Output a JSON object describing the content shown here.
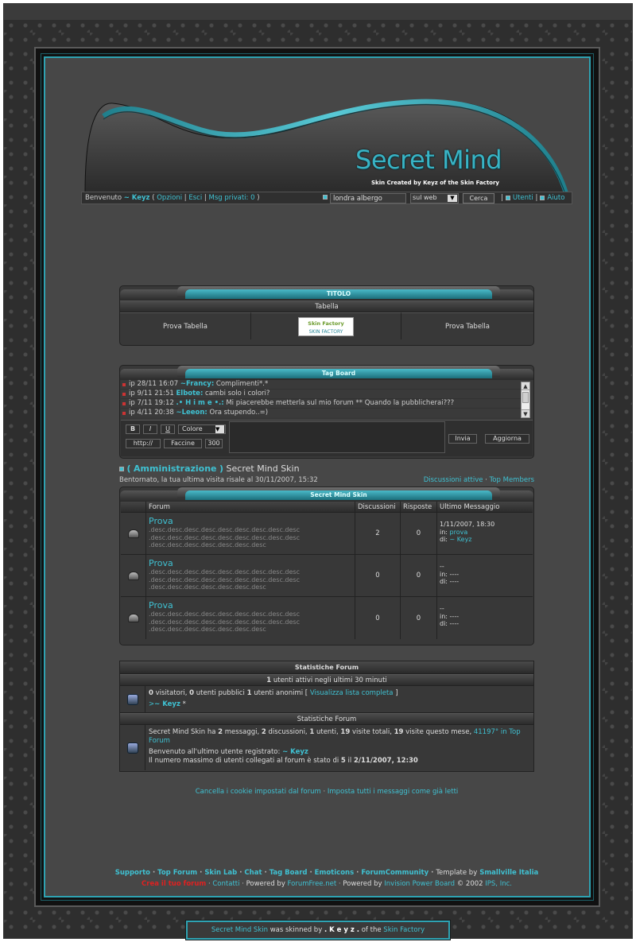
{
  "header": {
    "logo_title": "Secret Mind",
    "logo_subtitle": "Skin Created by Keyz of the Skin Factory"
  },
  "userbar": {
    "welcome": "Benvenuto",
    "user": "~ Keyz",
    "open_paren": "(",
    "options": "Opzioni",
    "sep1": "|",
    "logout": "Esci",
    "sep2": "|",
    "pm": "Msg privati: 0",
    "close_paren": ")",
    "search_value": "londra albergo",
    "search_scope": "sul web",
    "search_button": "Cerca",
    "users": "Utenti",
    "help": "Aiuto"
  },
  "table_panel": {
    "title": "TITOLO",
    "subtitle": "Tabella",
    "cell_left": "Prova Tabella",
    "cell_right": "Prova Tabella",
    "logo_line1": "Skin Factory",
    "logo_line2": "SKIN FACTORY"
  },
  "tagboard": {
    "title": "Tag Board",
    "messages": [
      {
        "ip": "ip",
        "date": "28/11 16:07",
        "user": "~Francy:",
        "text": "Complimenti*.*"
      },
      {
        "ip": "ip",
        "date": "9/11 21:51",
        "user": "Elbote:",
        "text": "cambi solo i colori?"
      },
      {
        "ip": "ip",
        "date": "7/11 19:12",
        "user": ".• H i m e •.:",
        "text": "Mi piacerebbe metterla sul mio forum ** Quando la pubblicherai???"
      },
      {
        "ip": "ip",
        "date": "4/11 20:38",
        "user": "~Leeon:",
        "text": "Ora stupendo..=)"
      }
    ],
    "bold_btn": "B",
    "italic_btn": "I",
    "underline_btn": "U",
    "color_select": "Colore",
    "http_btn": "http://",
    "smilies_btn": "Faccine",
    "char_count": "300",
    "send_btn": "Invia",
    "refresh_btn": "Aggiorna"
  },
  "forum_header": {
    "open": "(",
    "category": "Amministrazione",
    "close": ")",
    "title": "Secret Mind Skin",
    "welcome_back": "Bentornato, la tua ultima visita risale al 30/11/2007, 15:32",
    "active_topics": "Discussioni attive",
    "sep": "·",
    "top_members": "Top Members"
  },
  "forum": {
    "tab_title": "Secret Mind Skin",
    "columns": [
      "Forum",
      "Discussioni",
      "Risposte",
      "Ultimo Messaggio"
    ],
    "rows": [
      {
        "name": "Prova",
        "desc": ".desc.desc.desc.desc.desc.desc.desc.desc.desc .desc.desc.desc.desc.desc.desc.desc.desc.desc .desc.desc.desc.desc.desc.desc.desc",
        "topics": "2",
        "replies": "0",
        "last_date": "1/11/2007, 18:30",
        "last_in_label": "in:",
        "last_in": "prova",
        "last_by_label": "di:",
        "last_by": "~ Keyz"
      },
      {
        "name": "Prova",
        "desc": ".desc.desc.desc.desc.desc.desc.desc.desc.desc .desc.desc.desc.desc.desc.desc.desc.desc.desc .desc.desc.desc.desc.desc.desc.desc",
        "topics": "0",
        "replies": "0",
        "last_date": "--",
        "last_in_label": "in:",
        "last_in": "----",
        "last_by_label": "di:",
        "last_by": "----"
      },
      {
        "name": "Prova",
        "desc": ".desc.desc.desc.desc.desc.desc.desc.desc.desc .desc.desc.desc.desc.desc.desc.desc.desc.desc .desc.desc.desc.desc.desc.desc.desc",
        "topics": "0",
        "replies": "0",
        "last_date": "--",
        "last_in_label": "in:",
        "last_in": "----",
        "last_by_label": "di:",
        "last_by": "----"
      }
    ]
  },
  "stats": {
    "title": "Statistiche Forum",
    "active_count": "1",
    "active_text": "utenti attivi negli ultimi 30 minuti",
    "visitors_count": "0",
    "visitors_label": "visitatori,",
    "public_count": "0",
    "public_label": "utenti pubblici",
    "anon_count": "1",
    "anon_label": "utenti anonimi [",
    "view_list": "Visualizza lista completa",
    "view_list_close": "]",
    "online_user_prefix": ">",
    "online_user": "~ Keyz",
    "online_user_suffix": "*",
    "subtitle": "Statistiche Forum",
    "line1_a": "Secret Mind Skin ha",
    "line1_msgs": "2",
    "line1_b": "messaggi,",
    "line1_disc": "2",
    "line1_c": "discussioni,",
    "line1_users": "1",
    "line1_d": "utenti,",
    "line1_visits": "19",
    "line1_e": "visite totali,",
    "line1_month": "19",
    "line1_f": "visite questo mese,",
    "rank_link": "41197° in Top Forum",
    "line2_text": "Benvenuto all'ultimo utente registrato:",
    "line2_user": "~ Keyz",
    "line3_text": "Il numero massimo di utenti collegati al forum è stato di",
    "line3_max": "5",
    "line3_mid": "il",
    "line3_date": "2/11/2007, 12:30"
  },
  "footer": {
    "clear_cookies": "Cancella i cookie impostati dal forum",
    "sep": "·",
    "mark_read": "Imposta tutti i messaggi come già letti",
    "links": [
      "Supporto",
      "Top Forum",
      "Skin Lab",
      "Chat",
      "Tag Board",
      "Emoticons",
      "ForumCommunity"
    ],
    "template_by": "Template by",
    "template_author": "Smallville Italia",
    "free_forum": "Crea il tuo forum",
    "contacts": "Contatti",
    "powered_by": "Powered by",
    "forumfree": "ForumFree.net",
    "powered_by2": "Powered by",
    "ipb": "Invision Power Board",
    "copyright": "© 2002",
    "ips": "IPS, Inc."
  },
  "credit": {
    "a": "Secret Mind Skin",
    "b": "was skinned by",
    "c": ". K e y z .",
    "d": "of the",
    "e": "Skin Factory"
  },
  "colors": {
    "accent": "#3fc1d2",
    "frame": "#2ea2b2",
    "background": "#474747"
  }
}
